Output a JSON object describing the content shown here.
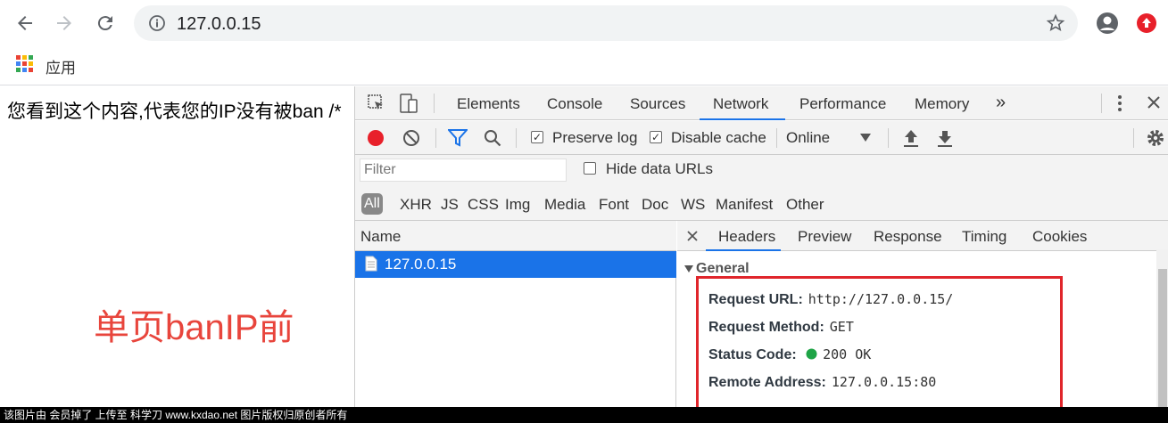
{
  "browser": {
    "url": "127.0.0.15",
    "bookmark_label": "应用"
  },
  "page": {
    "body_text": "您看到这个内容,代表您的IP没有被ban /*",
    "overlay_text": "单页banIP前"
  },
  "devtools": {
    "tabs": [
      "Elements",
      "Console",
      "Sources",
      "Network",
      "Performance",
      "Memory"
    ],
    "active_tab": "Network",
    "more_tabs": "»",
    "network_toolbar": {
      "preserve_log": "Preserve log",
      "disable_cache": "Disable cache",
      "throttle": "Online"
    },
    "filter": {
      "placeholder": "Filter",
      "hide_data_urls": "Hide data URLs"
    },
    "types": [
      "All",
      "XHR",
      "JS",
      "CSS",
      "Img",
      "Media",
      "Font",
      "Doc",
      "WS",
      "Manifest",
      "Other"
    ],
    "name_header": "Name",
    "request_name": "127.0.0.15",
    "detail_tabs": [
      "Headers",
      "Preview",
      "Response",
      "Timing",
      "Cookies"
    ],
    "general_label": "General",
    "general": {
      "request_url_label": "Request URL:",
      "request_url": "http://127.0.0.15/",
      "request_method_label": "Request Method:",
      "request_method": "GET",
      "status_code_label": "Status Code:",
      "status_code": "200 OK",
      "remote_address_label": "Remote Address:",
      "remote_address": "127.0.0.15:80"
    }
  },
  "colors": {
    "accent": "#1a73e8",
    "record": "#e8202a",
    "annotation": "#e8453c",
    "status_ok": "#1ea446"
  },
  "watermark": "该图片由 会员掉了 上传至 科学刀 www.kxdao.net 图片版权归原创者所有"
}
